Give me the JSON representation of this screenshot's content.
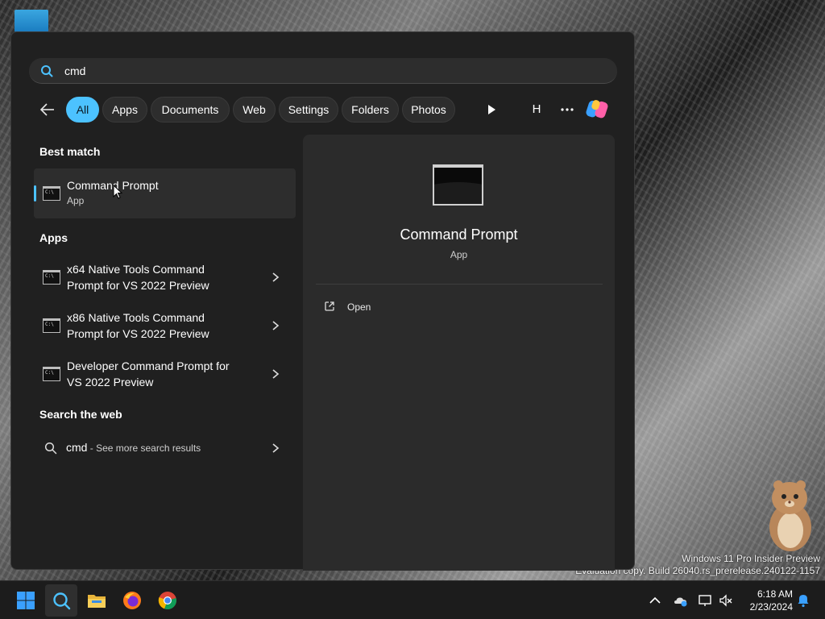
{
  "search": {
    "value": "cmd",
    "placeholder": ""
  },
  "filters": [
    "All",
    "Apps",
    "Documents",
    "Web",
    "Settings",
    "Folders",
    "Photos"
  ],
  "user_initial": "H",
  "best_match": {
    "heading": "Best match",
    "title": "Command Prompt",
    "subtitle": "App"
  },
  "apps": {
    "heading": "Apps",
    "items": [
      {
        "line1": "x64 Native Tools Command",
        "line2": "Prompt for VS 2022 Preview"
      },
      {
        "line1": "x86 Native Tools Command",
        "line2": "Prompt for VS 2022 Preview"
      },
      {
        "line1": "Developer Command Prompt for",
        "line2": "VS 2022 Preview"
      }
    ]
  },
  "web": {
    "heading": "Search the web",
    "query": "cmd",
    "more": " - See more search results"
  },
  "preview": {
    "title": "Command Prompt",
    "subtitle": "App",
    "action_open": "Open"
  },
  "watermark": {
    "line1": "Windows 11 Pro Insider Preview",
    "line2": "Evaluation copy. Build 26040.rs_prerelease.240122-1157"
  },
  "clock": {
    "time": "6:18 AM",
    "date": "2/23/2024"
  },
  "colors": {
    "accent": "#4cc2ff",
    "panel": "#202020",
    "preview": "#2b2b2b"
  },
  "icons": {
    "taskbar": [
      "windows-start-icon",
      "search-icon",
      "file-explorer-icon",
      "firefox-icon",
      "chrome-icon"
    ],
    "tray": [
      "chevron-up-icon",
      "onedrive-icon",
      "network-icon",
      "volume-muted-icon",
      "notification-bell-icon"
    ]
  }
}
